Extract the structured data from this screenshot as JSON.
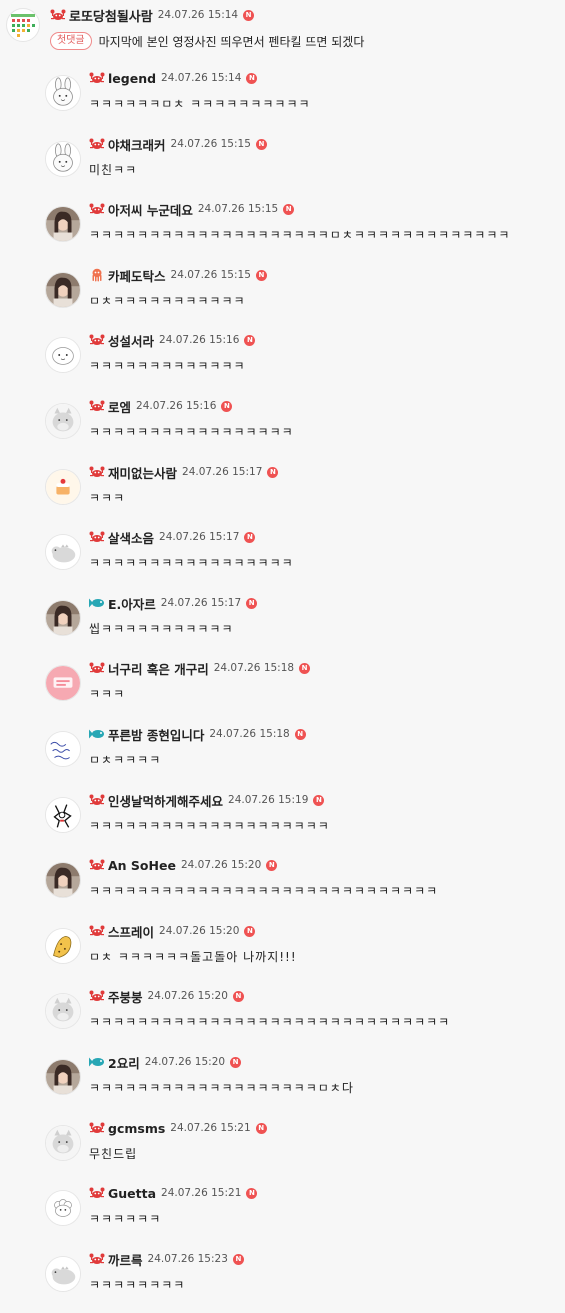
{
  "root_comment": {
    "nickname": "로또당첨될사람",
    "time": "24.07.26 15:14",
    "level_icon": "crab-icon",
    "new_badge": "N",
    "first_comment_badge": "첫댓글",
    "text": "마지막에 본인 영정사진 띄우면서 펜타킬 뜨면 되겠다"
  },
  "replies": [
    {
      "nickname": "legend",
      "time": "24.07.26 15:14",
      "level_icon": "crab-icon",
      "new_badge": "N",
      "text": "ㅋㅋㅋㅋㅋㅋㅁㅊ ㅋㅋㅋㅋㅋㅋㅋㅋㅋㅋ",
      "avatar": "rabbit-avatar"
    },
    {
      "nickname": "야채크래커",
      "time": "24.07.26 15:15",
      "level_icon": "crab-icon",
      "new_badge": "N",
      "text": "미친ㅋㅋ",
      "avatar": "rabbit-avatar"
    },
    {
      "nickname": "아저씨 누군데요",
      "time": "24.07.26 15:15",
      "level_icon": "crab-icon",
      "new_badge": "N",
      "text": "ㅋㅋㅋㅋㅋㅋㅋㅋㅋㅋㅋㅋㅋㅋㅋㅋㅋㅋㅋㅋㅁㅊㅋㅋㅋㅋㅋㅋㅋㅋㅋㅋㅋㅋㅋ",
      "avatar": "photo-avatar"
    },
    {
      "nickname": "카페도탁스",
      "time": "24.07.26 15:15",
      "level_icon": "octopus-icon",
      "new_badge": "N",
      "text": "ㅁㅊㅋㅋㅋㅋㅋㅋㅋㅋㅋㅋㅋ",
      "avatar": "photo-avatar"
    },
    {
      "nickname": "성설서라",
      "time": "24.07.26 15:16",
      "level_icon": "crab-icon",
      "new_badge": "N",
      "text": "ㅋㅋㅋㅋㅋㅋㅋㅋㅋㅋㅋㅋㅋ",
      "avatar": "face-avatar"
    },
    {
      "nickname": "로엠",
      "time": "24.07.26 15:16",
      "level_icon": "crab-icon",
      "new_badge": "N",
      "text": "ㅋㅋㅋㅋㅋㅋㅋㅋㅋㅋㅋㅋㅋㅋㅋㅋㅋ",
      "avatar": "cat-avatar"
    },
    {
      "nickname": "재미없는사람",
      "time": "24.07.26 15:17",
      "level_icon": "crab-icon",
      "new_badge": "N",
      "text": "ㅋㅋㅋ",
      "avatar": "cake-avatar"
    },
    {
      "nickname": "살색소음",
      "time": "24.07.26 15:17",
      "level_icon": "crab-icon",
      "new_badge": "N",
      "text": "ㅋㅋㅋㅋㅋㅋㅋㅋㅋㅋㅋㅋㅋㅋㅋㅋㅋ",
      "avatar": "dino-avatar"
    },
    {
      "nickname": "E.아자르",
      "time": "24.07.26 15:17",
      "level_icon": "fish-icon",
      "new_badge": "N",
      "text": "씹ㅋㅋㅋㅋㅋㅋㅋㅋㅋㅋㅋ",
      "avatar": "photo-avatar"
    },
    {
      "nickname": "너구리 혹은 개구리",
      "time": "24.07.26 15:18",
      "level_icon": "crab-icon",
      "new_badge": "N",
      "text": "ㅋㅋㅋ",
      "avatar": "pink-avatar"
    },
    {
      "nickname": "푸른밤 종현입니다",
      "time": "24.07.26 15:18",
      "level_icon": "fish-icon",
      "new_badge": "N",
      "text": "ㅁㅊㅋㅋㅋㅋ",
      "avatar": "handwriting-avatar"
    },
    {
      "nickname": "인생날먹하게해주세요",
      "time": "24.07.26 15:19",
      "level_icon": "crab-icon",
      "new_badge": "N",
      "text": "ㅋㅋㅋㅋㅋㅋㅋㅋㅋㅋㅋㅋㅋㅋㅋㅋㅋㅋㅋㅋ",
      "avatar": "sketch-avatar"
    },
    {
      "nickname": "An SoHee",
      "time": "24.07.26 15:20",
      "level_icon": "crab-icon",
      "new_badge": "N",
      "text": "ㅋㅋㅋㅋㅋㅋㅋㅋㅋㅋㅋㅋㅋㅋㅋㅋㅋㅋㅋㅋㅋㅋㅋㅋㅋㅋㅋㅋㅋ",
      "avatar": "photo-avatar"
    },
    {
      "nickname": "스프레이",
      "time": "24.07.26 15:20",
      "level_icon": "crab-icon",
      "new_badge": "N",
      "text": "ㅁㅊ ㅋㅋㅋㅋㅋㅋ돌고돌아 나까지!!!",
      "avatar": "cheetah-avatar"
    },
    {
      "nickname": "주붕붕",
      "time": "24.07.26 15:20",
      "level_icon": "crab-icon",
      "new_badge": "N",
      "text": "ㅋㅋㅋㅋㅋㅋㅋㅋㅋㅋㅋㅋㅋㅋㅋㅋㅋㅋㅋㅋㅋㅋㅋㅋㅋㅋㅋㅋㅋㅋ",
      "avatar": "cat-avatar"
    },
    {
      "nickname": "2요리",
      "time": "24.07.26 15:20",
      "level_icon": "fish-icon",
      "new_badge": "N",
      "text": "ㅋㅋㅋㅋㅋㅋㅋㅋㅋㅋㅋㅋㅋㅋㅋㅋㅋㅋㅋㅁㅊ다",
      "avatar": "photo-avatar"
    },
    {
      "nickname": "gcmsms",
      "time": "24.07.26 15:21",
      "level_icon": "crab-icon",
      "new_badge": "N",
      "text": "무친드립",
      "avatar": "cat-avatar"
    },
    {
      "nickname": "Guetta",
      "time": "24.07.26 15:21",
      "level_icon": "crab-icon",
      "new_badge": "N",
      "text": "ㅋㅋㅋㅋㅋㅋ",
      "avatar": "sheep-avatar"
    },
    {
      "nickname": "까르륵",
      "time": "24.07.26 15:23",
      "level_icon": "crab-icon",
      "new_badge": "N",
      "text": "ㅋㅋㅋㅋㅋㅋㅋㅋ",
      "avatar": "dino-avatar"
    }
  ],
  "colors": {
    "crab": "#e03a3a",
    "octopus": "#f0724f",
    "fish": "#28a7b5",
    "new_badge": "#ef5252"
  }
}
